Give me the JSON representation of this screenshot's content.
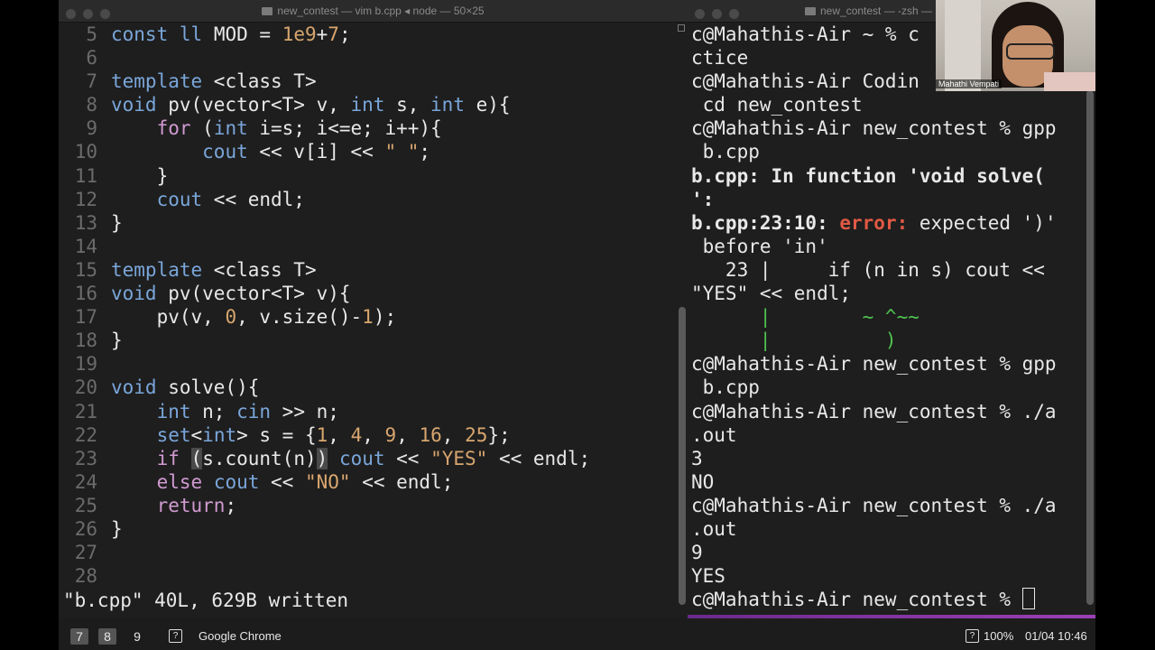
{
  "vim": {
    "title": "new_contest — vim b.cpp ◂ node — 50×25",
    "status": "\"b.cpp\" 40L, 629B written",
    "lines": {
      "n5": "5",
      "n6": "6",
      "n7": "7",
      "n8": "8",
      "n9": "9",
      "n10": "10",
      "n11": "11",
      "n12": "12",
      "n13": "13",
      "n14": "14",
      "n15": "15",
      "n16": "16",
      "n17": "17",
      "n18": "18",
      "n19": "19",
      "n20": "20",
      "n21": "21",
      "n22": "22",
      "n23": "23",
      "n24": "24",
      "n25": "25",
      "n26": "26",
      "n27": "27",
      "n28": "28"
    }
  },
  "zsh": {
    "title": "new_contest — -zsh — 5",
    "lines": [
      "c@Mahathis-Air ~ % c",
      "ctice",
      "c@Mahathis-Air Codin",
      " cd new_contest",
      "c@Mahathis-Air new_contest % gpp",
      " b.cpp",
      "b.cpp: In function 'void solve(",
      "':",
      "b.cpp:23:10: error: expected ')'",
      " before 'in'",
      "   23 |     if (n in s) cout <<",
      "\"YES\" << endl;",
      "      |        ~ ^~~",
      "      |          )",
      "c@Mahathis-Air new_contest % gpp",
      " b.cpp",
      "c@Mahathis-Air new_contest % ./a",
      ".out",
      "3",
      "NO",
      "c@Mahathis-Air new_contest % ./a",
      ".out",
      "9",
      "YES",
      "c@Mahathis-Air new_contest % "
    ]
  },
  "webcam": {
    "name": "Mahathi Vempati"
  },
  "taskbar": {
    "workspaces": [
      "7",
      "8",
      "9"
    ],
    "app": "Google Chrome",
    "zoom": "100%",
    "clock": "01/04 10:46"
  }
}
